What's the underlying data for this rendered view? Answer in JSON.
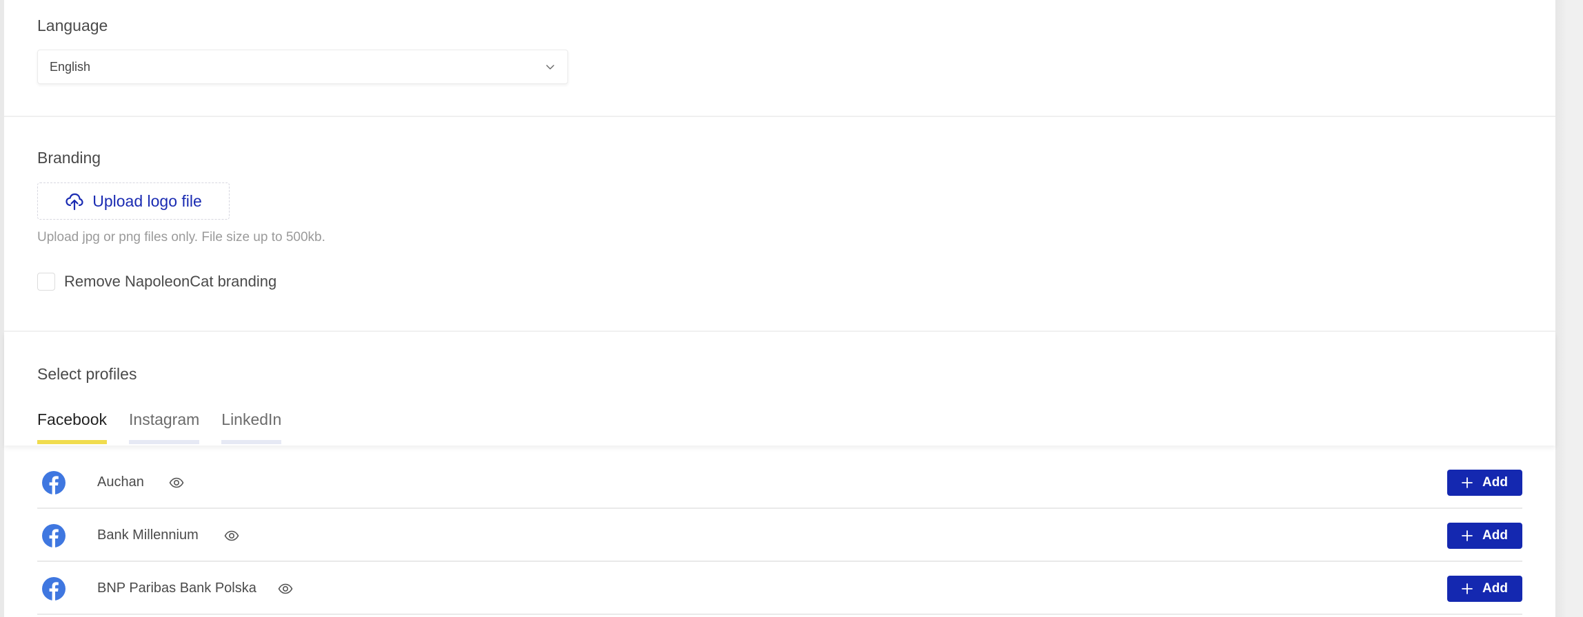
{
  "language": {
    "title": "Language",
    "selected": "English"
  },
  "branding": {
    "title": "Branding",
    "upload_label": "Upload logo file",
    "helper_text": "Upload jpg or png files only. File size up to 500kb.",
    "checkbox_label": "Remove NapoleonCat branding",
    "checkbox_checked": false
  },
  "profiles": {
    "title": "Select profiles",
    "tabs": [
      {
        "label": "Facebook",
        "active": true
      },
      {
        "label": "Instagram",
        "active": false
      },
      {
        "label": "LinkedIn",
        "active": false
      }
    ],
    "rows": [
      {
        "network": "facebook",
        "name": "Auchan",
        "action_label": "Add"
      },
      {
        "network": "facebook",
        "name": "Bank Millennium",
        "action_label": "Add"
      },
      {
        "network": "facebook",
        "name": "BNP Paribas Bank Polska",
        "action_label": "Add"
      }
    ]
  },
  "colors": {
    "primary": "#1428b0",
    "link": "#1a2bb2",
    "active_tab_underline": "#f0dc4e",
    "inactive_tab_underline": "#e6e9f4",
    "facebook": "#3f77e0"
  }
}
